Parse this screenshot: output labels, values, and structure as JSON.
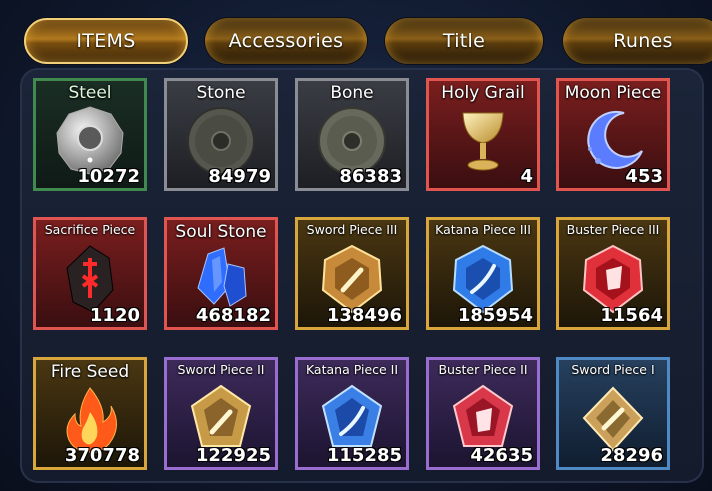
{
  "tabs": [
    {
      "label": "ITEMS",
      "active": true
    },
    {
      "label": "Accessories",
      "active": false
    },
    {
      "label": "Title",
      "active": false
    },
    {
      "label": "Runes",
      "active": false
    }
  ],
  "items": [
    {
      "name": "Steel",
      "count": "10272",
      "rarity": "green",
      "icon": "steel-disc-icon"
    },
    {
      "name": "Stone",
      "count": "84979",
      "rarity": "gray",
      "icon": "stone-disc-icon"
    },
    {
      "name": "Bone",
      "count": "86383",
      "rarity": "gray",
      "icon": "bone-disc-icon"
    },
    {
      "name": "Holy Grail",
      "count": "4",
      "rarity": "red",
      "icon": "holy-grail-icon"
    },
    {
      "name": "Moon Piece",
      "count": "453",
      "rarity": "red",
      "icon": "moon-piece-icon"
    },
    {
      "name": "Sacrifice Piece",
      "count": "1120",
      "rarity": "red",
      "icon": "sacrifice-rune-icon"
    },
    {
      "name": "Soul Stone",
      "count": "468182",
      "rarity": "red",
      "icon": "soul-stone-crystal-icon"
    },
    {
      "name": "Sword Piece III",
      "count": "138496",
      "rarity": "orange",
      "icon": "sword-piece-gem-icon"
    },
    {
      "name": "Katana Piece III",
      "count": "185954",
      "rarity": "orange",
      "icon": "katana-piece-gem-icon"
    },
    {
      "name": "Buster Piece III",
      "count": "11564",
      "rarity": "orange",
      "icon": "buster-piece-gem-icon"
    },
    {
      "name": "Fire Seed",
      "count": "370778",
      "rarity": "orange",
      "icon": "fire-seed-icon"
    },
    {
      "name": "Sword Piece II",
      "count": "122925",
      "rarity": "purple",
      "icon": "sword-piece-gem-icon"
    },
    {
      "name": "Katana Piece II",
      "count": "115285",
      "rarity": "purple",
      "icon": "katana-piece-gem-icon"
    },
    {
      "name": "Buster Piece II",
      "count": "42635",
      "rarity": "purple",
      "icon": "buster-piece-gem-icon"
    },
    {
      "name": "Sword Piece I",
      "count": "28296",
      "rarity": "blue",
      "icon": "sword-piece-gem-icon"
    }
  ],
  "colors": {
    "tab_gold": "#b27a1e",
    "green": "#3f8a4c",
    "gray": "#8a8d94",
    "red": "#e0554f",
    "orange": "#d9a63c",
    "purple": "#9a6dd0",
    "blue": "#4f8ac4"
  }
}
